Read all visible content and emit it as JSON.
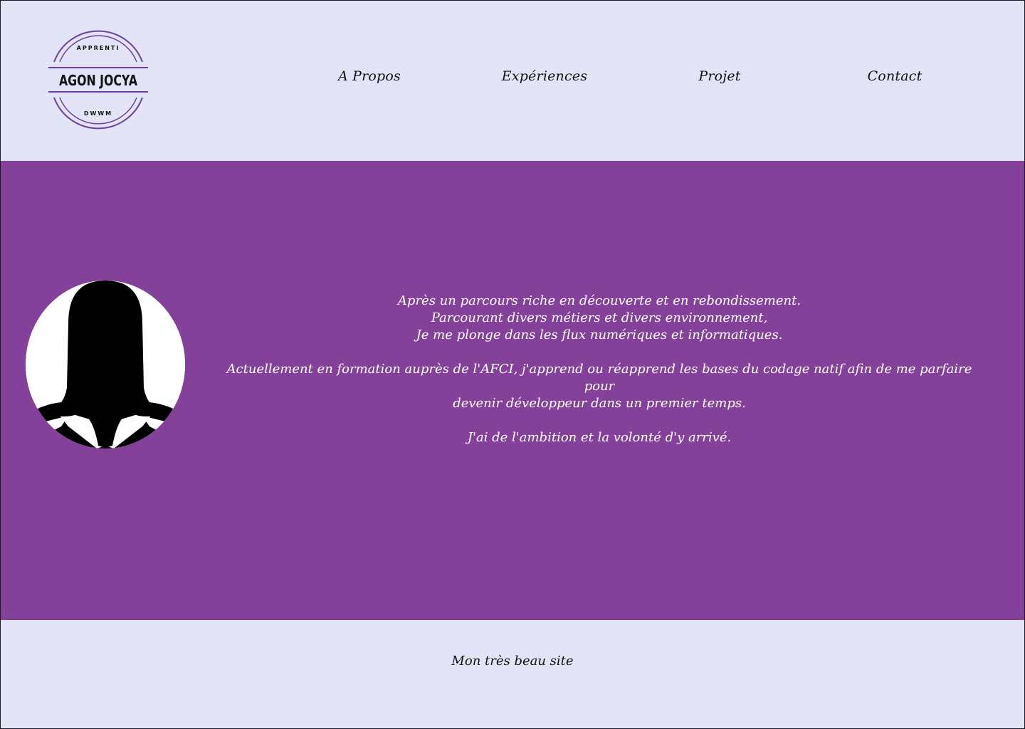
{
  "header": {
    "logo": {
      "top_text": "APPRENTI",
      "name": "AGON JOCYA",
      "bottom_text": "DWWM",
      "ring_color": "#6b3fa8"
    },
    "nav": [
      {
        "label": "A Propos"
      },
      {
        "label": "Expériences"
      },
      {
        "label": "Projet"
      },
      {
        "label": "Contact"
      }
    ]
  },
  "main": {
    "avatar_icon": "female-silhouette-avatar",
    "bio": {
      "line1": "Après un parcours riche en découverte et en rebondissement.",
      "line2": "Parcourant divers métiers et divers environnement,",
      "line3": "Je me plonge dans les flux numériques et informatiques.",
      "line4": "Actuellement en formation auprès de l'AFCI, j'apprend ou réapprend les bases du codage natif afin de me parfaire pour",
      "line5": "devenir développeur dans un premier temps.",
      "line6": "J'ai de l'ambition et la volonté d'y arrivé."
    },
    "background_color": "#84419a"
  },
  "footer": {
    "text": "Mon très beau site"
  },
  "colors": {
    "page_background": "#e4e4f8",
    "accent_purple": "#84419a",
    "text_light": "#ffffff",
    "text_dark": "#111111"
  }
}
